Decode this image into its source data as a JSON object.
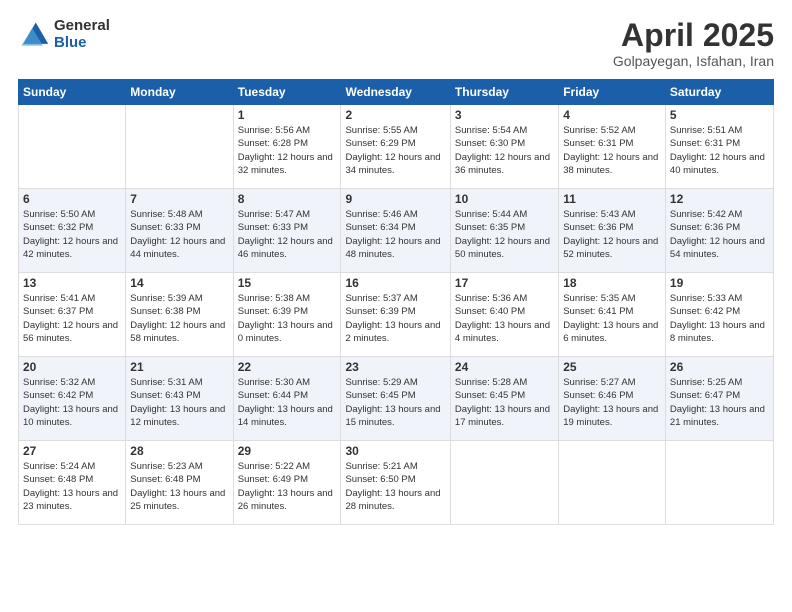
{
  "header": {
    "logo_general": "General",
    "logo_blue": "Blue",
    "title": "April 2025",
    "subtitle": "Golpayegan, Isfahan, Iran"
  },
  "weekdays": [
    "Sunday",
    "Monday",
    "Tuesday",
    "Wednesday",
    "Thursday",
    "Friday",
    "Saturday"
  ],
  "rows": [
    [
      {
        "day": "",
        "sunrise": "",
        "sunset": "",
        "daylight": ""
      },
      {
        "day": "",
        "sunrise": "",
        "sunset": "",
        "daylight": ""
      },
      {
        "day": "1",
        "sunrise": "Sunrise: 5:56 AM",
        "sunset": "Sunset: 6:28 PM",
        "daylight": "Daylight: 12 hours and 32 minutes."
      },
      {
        "day": "2",
        "sunrise": "Sunrise: 5:55 AM",
        "sunset": "Sunset: 6:29 PM",
        "daylight": "Daylight: 12 hours and 34 minutes."
      },
      {
        "day": "3",
        "sunrise": "Sunrise: 5:54 AM",
        "sunset": "Sunset: 6:30 PM",
        "daylight": "Daylight: 12 hours and 36 minutes."
      },
      {
        "day": "4",
        "sunrise": "Sunrise: 5:52 AM",
        "sunset": "Sunset: 6:31 PM",
        "daylight": "Daylight: 12 hours and 38 minutes."
      },
      {
        "day": "5",
        "sunrise": "Sunrise: 5:51 AM",
        "sunset": "Sunset: 6:31 PM",
        "daylight": "Daylight: 12 hours and 40 minutes."
      }
    ],
    [
      {
        "day": "6",
        "sunrise": "Sunrise: 5:50 AM",
        "sunset": "Sunset: 6:32 PM",
        "daylight": "Daylight: 12 hours and 42 minutes."
      },
      {
        "day": "7",
        "sunrise": "Sunrise: 5:48 AM",
        "sunset": "Sunset: 6:33 PM",
        "daylight": "Daylight: 12 hours and 44 minutes."
      },
      {
        "day": "8",
        "sunrise": "Sunrise: 5:47 AM",
        "sunset": "Sunset: 6:33 PM",
        "daylight": "Daylight: 12 hours and 46 minutes."
      },
      {
        "day": "9",
        "sunrise": "Sunrise: 5:46 AM",
        "sunset": "Sunset: 6:34 PM",
        "daylight": "Daylight: 12 hours and 48 minutes."
      },
      {
        "day": "10",
        "sunrise": "Sunrise: 5:44 AM",
        "sunset": "Sunset: 6:35 PM",
        "daylight": "Daylight: 12 hours and 50 minutes."
      },
      {
        "day": "11",
        "sunrise": "Sunrise: 5:43 AM",
        "sunset": "Sunset: 6:36 PM",
        "daylight": "Daylight: 12 hours and 52 minutes."
      },
      {
        "day": "12",
        "sunrise": "Sunrise: 5:42 AM",
        "sunset": "Sunset: 6:36 PM",
        "daylight": "Daylight: 12 hours and 54 minutes."
      }
    ],
    [
      {
        "day": "13",
        "sunrise": "Sunrise: 5:41 AM",
        "sunset": "Sunset: 6:37 PM",
        "daylight": "Daylight: 12 hours and 56 minutes."
      },
      {
        "day": "14",
        "sunrise": "Sunrise: 5:39 AM",
        "sunset": "Sunset: 6:38 PM",
        "daylight": "Daylight: 12 hours and 58 minutes."
      },
      {
        "day": "15",
        "sunrise": "Sunrise: 5:38 AM",
        "sunset": "Sunset: 6:39 PM",
        "daylight": "Daylight: 13 hours and 0 minutes."
      },
      {
        "day": "16",
        "sunrise": "Sunrise: 5:37 AM",
        "sunset": "Sunset: 6:39 PM",
        "daylight": "Daylight: 13 hours and 2 minutes."
      },
      {
        "day": "17",
        "sunrise": "Sunrise: 5:36 AM",
        "sunset": "Sunset: 6:40 PM",
        "daylight": "Daylight: 13 hours and 4 minutes."
      },
      {
        "day": "18",
        "sunrise": "Sunrise: 5:35 AM",
        "sunset": "Sunset: 6:41 PM",
        "daylight": "Daylight: 13 hours and 6 minutes."
      },
      {
        "day": "19",
        "sunrise": "Sunrise: 5:33 AM",
        "sunset": "Sunset: 6:42 PM",
        "daylight": "Daylight: 13 hours and 8 minutes."
      }
    ],
    [
      {
        "day": "20",
        "sunrise": "Sunrise: 5:32 AM",
        "sunset": "Sunset: 6:42 PM",
        "daylight": "Daylight: 13 hours and 10 minutes."
      },
      {
        "day": "21",
        "sunrise": "Sunrise: 5:31 AM",
        "sunset": "Sunset: 6:43 PM",
        "daylight": "Daylight: 13 hours and 12 minutes."
      },
      {
        "day": "22",
        "sunrise": "Sunrise: 5:30 AM",
        "sunset": "Sunset: 6:44 PM",
        "daylight": "Daylight: 13 hours and 14 minutes."
      },
      {
        "day": "23",
        "sunrise": "Sunrise: 5:29 AM",
        "sunset": "Sunset: 6:45 PM",
        "daylight": "Daylight: 13 hours and 15 minutes."
      },
      {
        "day": "24",
        "sunrise": "Sunrise: 5:28 AM",
        "sunset": "Sunset: 6:45 PM",
        "daylight": "Daylight: 13 hours and 17 minutes."
      },
      {
        "day": "25",
        "sunrise": "Sunrise: 5:27 AM",
        "sunset": "Sunset: 6:46 PM",
        "daylight": "Daylight: 13 hours and 19 minutes."
      },
      {
        "day": "26",
        "sunrise": "Sunrise: 5:25 AM",
        "sunset": "Sunset: 6:47 PM",
        "daylight": "Daylight: 13 hours and 21 minutes."
      }
    ],
    [
      {
        "day": "27",
        "sunrise": "Sunrise: 5:24 AM",
        "sunset": "Sunset: 6:48 PM",
        "daylight": "Daylight: 13 hours and 23 minutes."
      },
      {
        "day": "28",
        "sunrise": "Sunrise: 5:23 AM",
        "sunset": "Sunset: 6:48 PM",
        "daylight": "Daylight: 13 hours and 25 minutes."
      },
      {
        "day": "29",
        "sunrise": "Sunrise: 5:22 AM",
        "sunset": "Sunset: 6:49 PM",
        "daylight": "Daylight: 13 hours and 26 minutes."
      },
      {
        "day": "30",
        "sunrise": "Sunrise: 5:21 AM",
        "sunset": "Sunset: 6:50 PM",
        "daylight": "Daylight: 13 hours and 28 minutes."
      },
      {
        "day": "",
        "sunrise": "",
        "sunset": "",
        "daylight": ""
      },
      {
        "day": "",
        "sunrise": "",
        "sunset": "",
        "daylight": ""
      },
      {
        "day": "",
        "sunrise": "",
        "sunset": "",
        "daylight": ""
      }
    ]
  ]
}
